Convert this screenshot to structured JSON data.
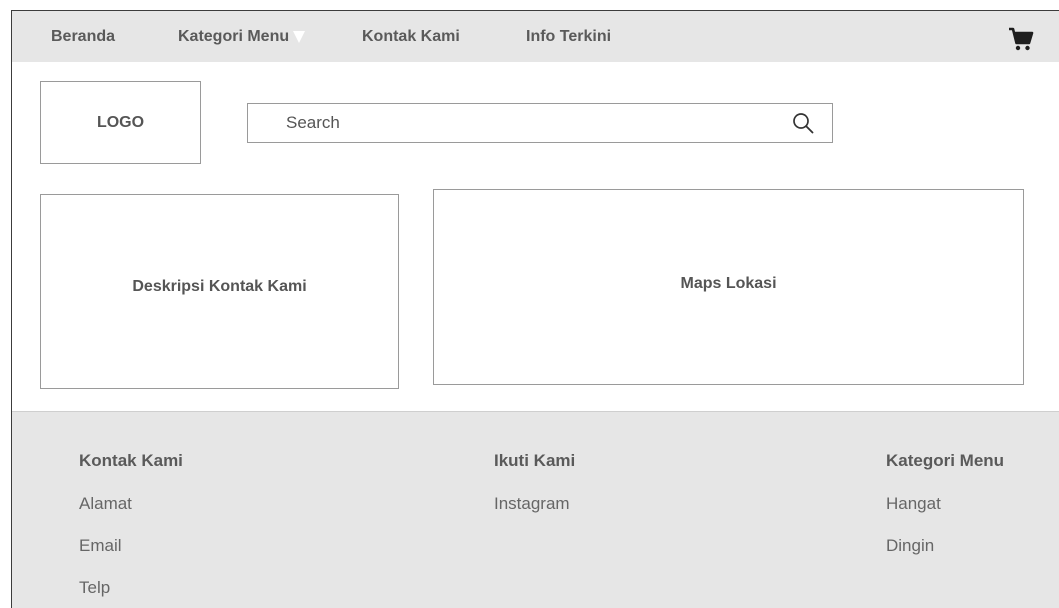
{
  "nav": {
    "items": [
      {
        "label": "Beranda"
      },
      {
        "label": "Kategori Menu"
      },
      {
        "label": "Kontak Kami"
      },
      {
        "label": "Info Terkini"
      }
    ],
    "cart_icon": "shopping-cart-icon"
  },
  "header": {
    "logo": "LOGO",
    "search": {
      "placeholder": "Search",
      "icon": "search-icon"
    }
  },
  "main": {
    "description_panel": "Deskripsi Kontak Kami",
    "map_panel": "Maps Lokasi"
  },
  "footer": {
    "columns": [
      {
        "heading": "Kontak Kami",
        "links": [
          "Alamat",
          "Email",
          "Telp"
        ]
      },
      {
        "heading": "Ikuti Kami",
        "links": [
          "Instagram"
        ]
      },
      {
        "heading": "Kategori Menu",
        "links": [
          "Hangat",
          "Dingin"
        ]
      }
    ]
  },
  "colors": {
    "bar_background": "#e6e6e6",
    "text": "#555555",
    "border": "#9a9a9a"
  }
}
